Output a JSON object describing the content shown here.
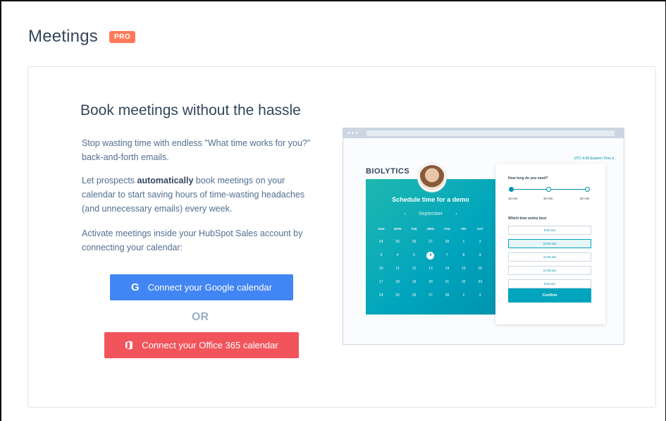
{
  "header": {
    "title": "Meetings",
    "badge": "PRO"
  },
  "main": {
    "headline": "Book meetings without the hassle",
    "paragraph1": "Stop wasting time with endless \"What time works for you?\" back-and-forth emails.",
    "paragraph2_pre": "Let prospects ",
    "paragraph2_bold": "automatically",
    "paragraph2_post": " book meetings on your calendar to start saving hours of time-wasting headaches (and unnecessary emails) every week.",
    "paragraph3": "Activate meetings inside your HubSpot Sales account by connecting your calendar:",
    "google_button": "Connect your Google calendar",
    "google_icon": "G",
    "or": "OR",
    "office_button": "Connect your Office 365 calendar"
  },
  "mock": {
    "timezone": "UTC-4:00 Eastern Time ▾",
    "brand": "BIOLYTICS",
    "cal_title": "Schedule time for a demo",
    "month": "September",
    "prev": "‹",
    "next": "›",
    "days": [
      "SUN",
      "MON",
      "TUE",
      "WED",
      "THU",
      "FRI",
      "SAT"
    ],
    "weeks": [
      [
        "24",
        "25",
        "26",
        "27",
        "28",
        "1",
        "2"
      ],
      [
        "3",
        "4",
        "5",
        "6",
        "7",
        "8",
        "9"
      ],
      [
        "10",
        "11",
        "12",
        "13",
        "14",
        "15",
        "16"
      ],
      [
        "17",
        "18",
        "19",
        "20",
        "21",
        "22",
        "23"
      ],
      [
        "24",
        "25",
        "26",
        "27",
        "28",
        "1",
        "2"
      ]
    ],
    "selected_day": "6",
    "q1": "How long do you need?",
    "durations": [
      "15 min",
      "30 min",
      "60 min"
    ],
    "q2": "Which time works best",
    "times": [
      "9:00 am",
      "10:00 am",
      "11:00 am",
      "12:00 pm",
      "9:00 am"
    ],
    "confirm": "Confirm",
    "colors": {
      "teal": "#00a4bd",
      "google": "#4285f4",
      "office": "#f2545b",
      "pro": "#ff7a59"
    }
  }
}
